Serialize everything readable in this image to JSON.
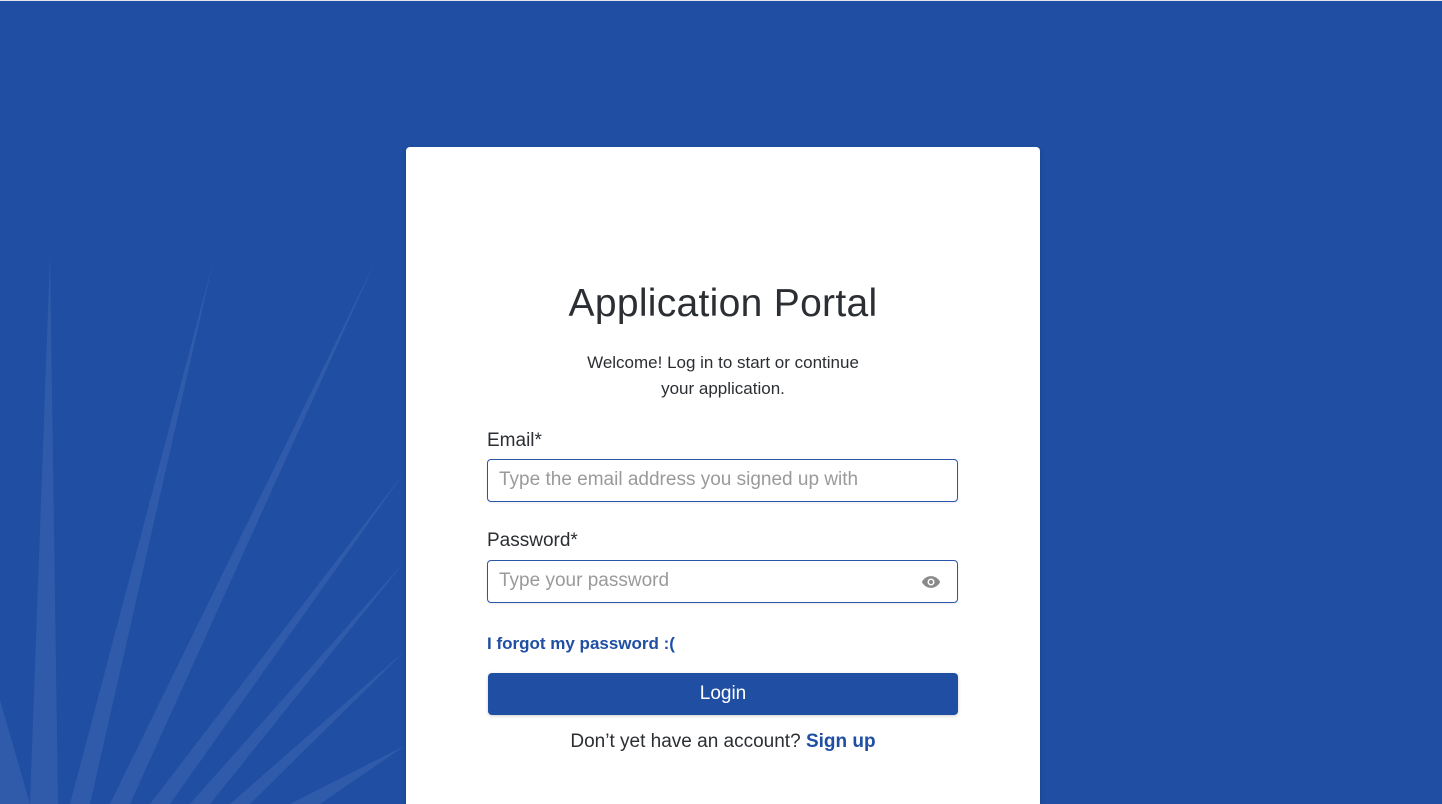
{
  "colors": {
    "background": "#1f4ea3",
    "accent": "#1f4ea3",
    "card": "#ffffff",
    "placeholder": "#9a9a9a"
  },
  "login": {
    "title": "Application Portal",
    "subtitle": "Welcome! Log in to start or continue your application.",
    "email": {
      "label": "Email*",
      "placeholder": "Type the email address you signed up with",
      "value": ""
    },
    "password": {
      "label": "Password*",
      "placeholder": "Type your password",
      "value": "",
      "toggle_icon": "eye-icon"
    },
    "forgot_link": "I forgot my password :(",
    "login_button": "Login",
    "signup_prompt": "Don’t yet have an account?",
    "signup_link": "Sign up"
  }
}
